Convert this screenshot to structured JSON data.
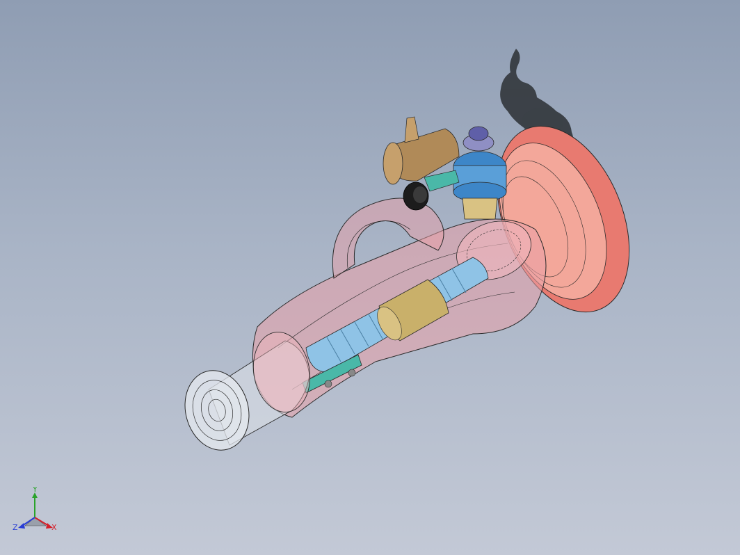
{
  "viewport": {
    "background_top": "#8f9db3",
    "background_bottom": "#c3c9d6"
  },
  "model": {
    "colors": {
      "housing": "#e9a0a8",
      "flange": "#e87a70",
      "thread": "#8fc3e6",
      "sleeve": "#c9b06a",
      "valve_body": "#b08a58",
      "knob": "#4a5bc0",
      "valve_ring": "#3d86c8",
      "bracket": "#4ab8a8",
      "smoke": "#2c3034",
      "edge": "#2a2a2a"
    }
  },
  "triad": {
    "y_label": "Y",
    "x_label": "X",
    "z_label": "Z",
    "colors": {
      "x": "#d4202a",
      "y": "#2aa32a",
      "z": "#2a3ed4"
    }
  }
}
